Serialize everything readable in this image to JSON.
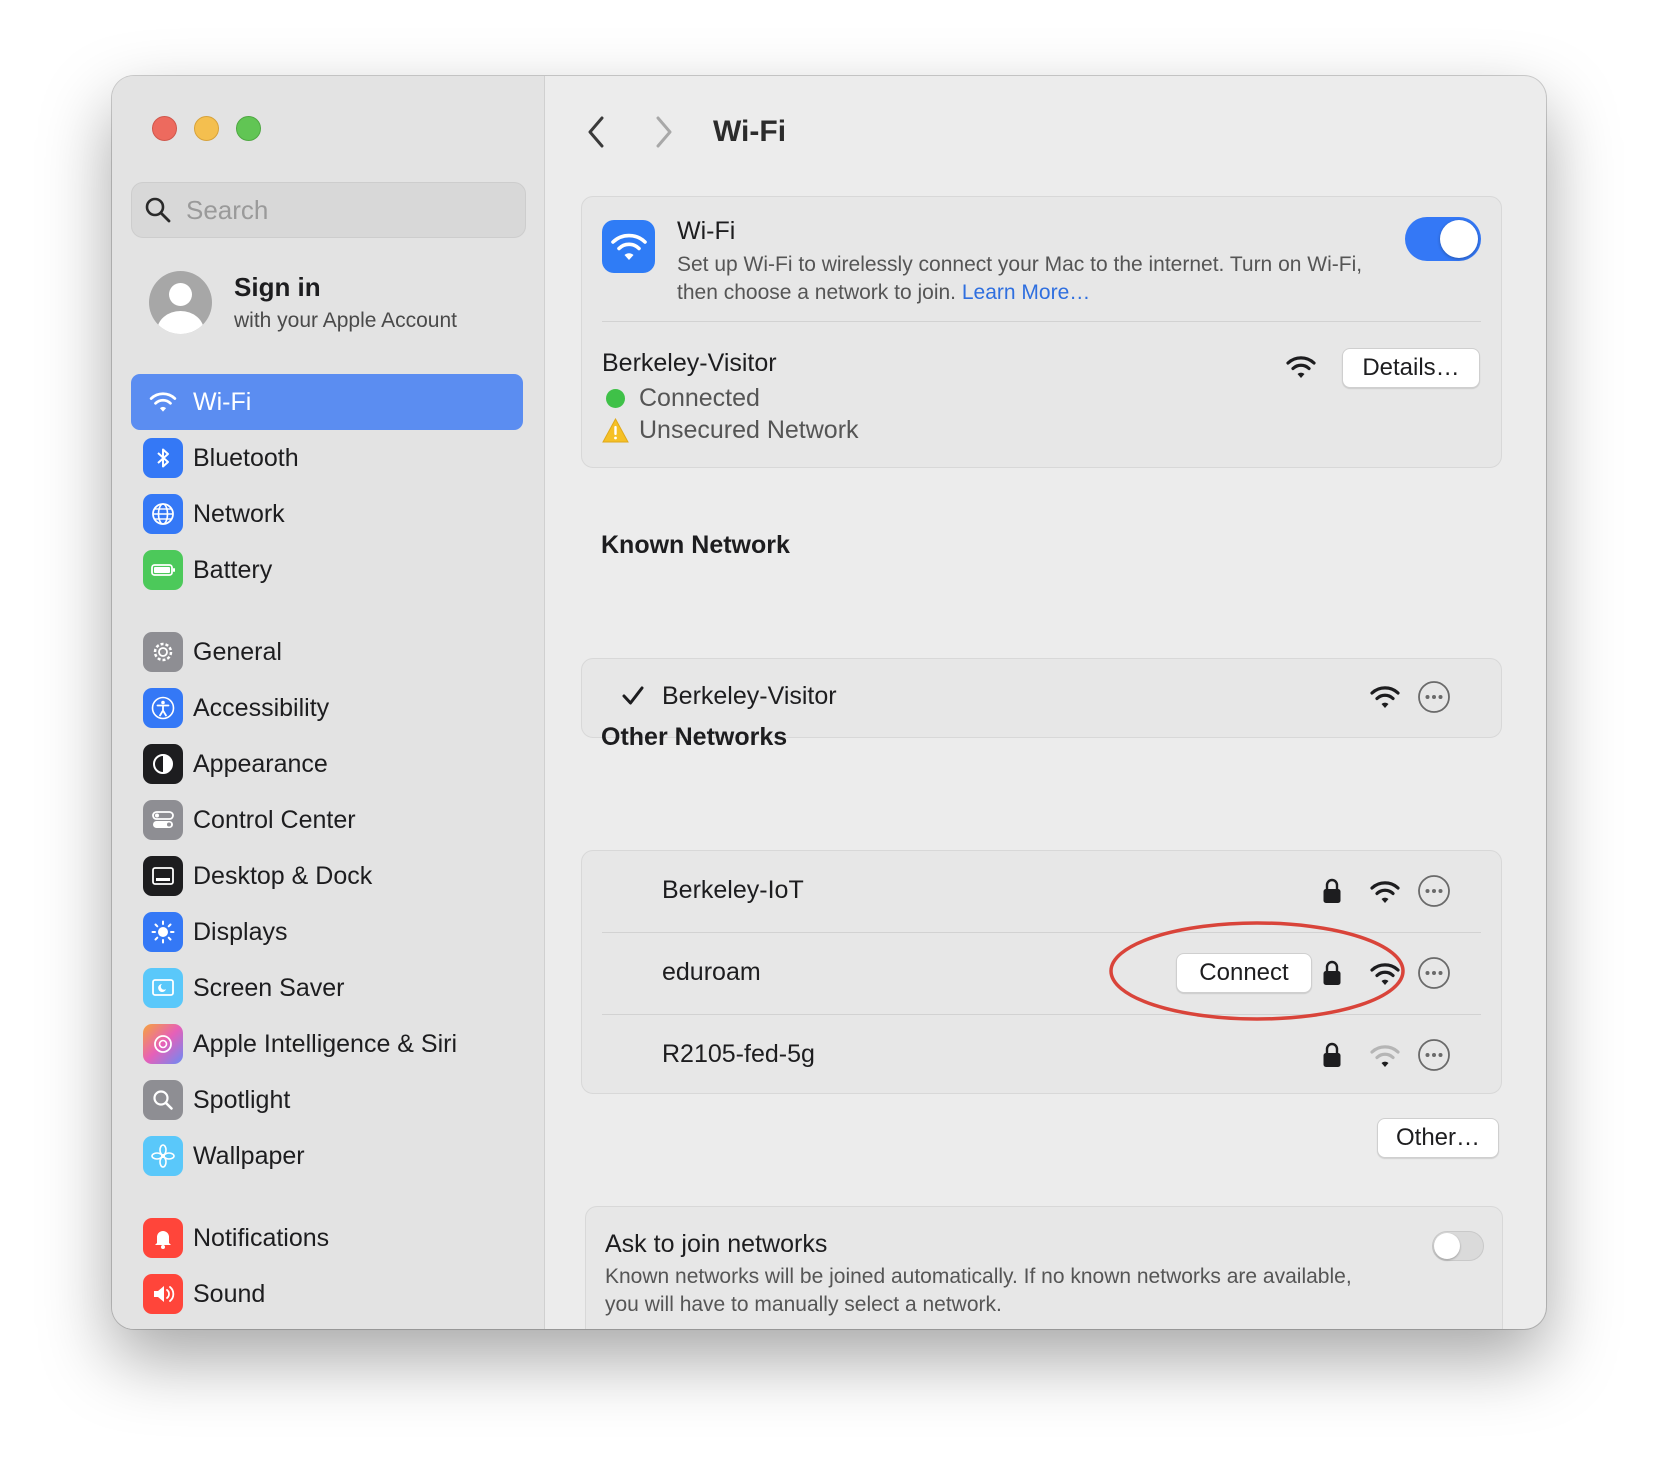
{
  "sidebar": {
    "search_placeholder": "Search",
    "account": {
      "title": "Sign in",
      "subtitle": "with your Apple Account"
    },
    "items": [
      {
        "label": "Wi-Fi",
        "icon": "wifi-icon",
        "color": "#5b8df1"
      },
      {
        "label": "Bluetooth",
        "icon": "bluetooth-icon",
        "color": "#3478f6"
      },
      {
        "label": "Network",
        "icon": "globe-icon",
        "color": "#3478f6"
      },
      {
        "label": "Battery",
        "icon": "battery-icon",
        "color": "#4cc95a"
      },
      {
        "label": "General",
        "icon": "gear-icon",
        "color": "#8e8e93"
      },
      {
        "label": "Accessibility",
        "icon": "accessibility-icon",
        "color": "#3478f6"
      },
      {
        "label": "Appearance",
        "icon": "appearance-icon",
        "color": "#1d1d1f"
      },
      {
        "label": "Control Center",
        "icon": "control-center-icon",
        "color": "#8e8e93"
      },
      {
        "label": "Desktop & Dock",
        "icon": "dock-icon",
        "color": "#1d1d1f"
      },
      {
        "label": "Displays",
        "icon": "sun-icon",
        "color": "#3478f6"
      },
      {
        "label": "Screen Saver",
        "icon": "screen-saver-icon",
        "color": "#5ac8fa"
      },
      {
        "label": "Apple Intelligence & Siri",
        "icon": "siri-icon",
        "color": "#e07bd0"
      },
      {
        "label": "Spotlight",
        "icon": "spotlight-icon",
        "color": "#8e8e93"
      },
      {
        "label": "Wallpaper",
        "icon": "wallpaper-icon",
        "color": "#5ac8fa"
      },
      {
        "label": "Notifications",
        "icon": "bell-icon",
        "color": "#ff453a"
      },
      {
        "label": "Sound",
        "icon": "speaker-icon",
        "color": "#ff453a"
      }
    ]
  },
  "header": {
    "title": "Wi-Fi"
  },
  "wifi": {
    "title": "Wi-Fi",
    "description": "Set up Wi-Fi to wirelessly connect your Mac to the internet. Turn on Wi-Fi, then choose a network to join.",
    "learn_more": "Learn More…",
    "enabled": true,
    "current": {
      "name": "Berkeley-Visitor",
      "status": "Connected",
      "warning": "Unsecured Network",
      "details_label": "Details…"
    }
  },
  "known": {
    "title": "Known Network",
    "networks": [
      {
        "name": "Berkeley-Visitor",
        "checked": true
      }
    ]
  },
  "other": {
    "title": "Other Networks",
    "connect_label": "Connect",
    "networks": [
      {
        "name": "Berkeley-IoT",
        "locked": true,
        "signal": "strong"
      },
      {
        "name": "eduroam",
        "locked": true,
        "signal": "strong"
      },
      {
        "name": "R2105-fed-5g",
        "locked": true,
        "signal": "weak"
      }
    ],
    "other_label": "Other…"
  },
  "ask": {
    "title": "Ask to join networks",
    "description": "Known networks will be joined automatically. If no known networks are available, you will have to manually select a network.",
    "enabled": false
  },
  "colors": {
    "accent": "#3478f6",
    "annotation": "#d9443a"
  }
}
